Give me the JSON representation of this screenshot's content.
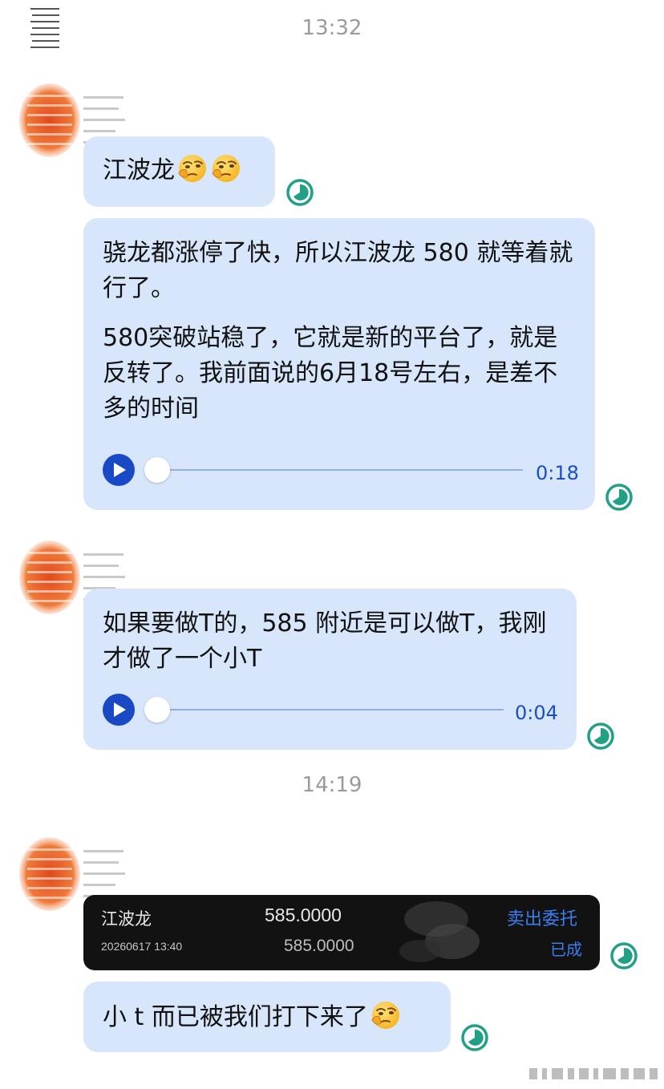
{
  "timestamps": [
    "13:32",
    "14:19"
  ],
  "messages": [
    {
      "text": "江波龙",
      "emojis": 2
    },
    {
      "paragraphs": [
        "骁龙都涨停了快，所以江波龙 580 就等着就行了。",
        "580突破站稳了，它就是新的平台了，就是反转了。我前面说的6月18号左右，是差不多的时间"
      ],
      "duration": "0:18"
    },
    {
      "paragraphs": [
        "如果要做T的，585 附近是可以做T，我刚才做了一个小T"
      ],
      "duration": "0:04"
    },
    {
      "trade_card": {
        "name": "江波龙",
        "price": "585.0000",
        "action": "卖出委托",
        "datetime": "20260617 13:40",
        "filled_price": "585.0000",
        "status": "已成"
      }
    },
    {
      "text": "小 t 而已被我们打下来了",
      "emojis": 1
    }
  ],
  "colors": {
    "bubble": "#d7e6fb",
    "play_button": "#1949c4",
    "duration_text": "#1a4fc4",
    "status_icon": "#21a086",
    "timestamp": "#9a9a9a",
    "card_bg": "#121212",
    "card_action": "#3b7cf0"
  },
  "icons": [
    "avatar",
    "play-icon",
    "read-status-icon",
    "thinking-emoji"
  ]
}
